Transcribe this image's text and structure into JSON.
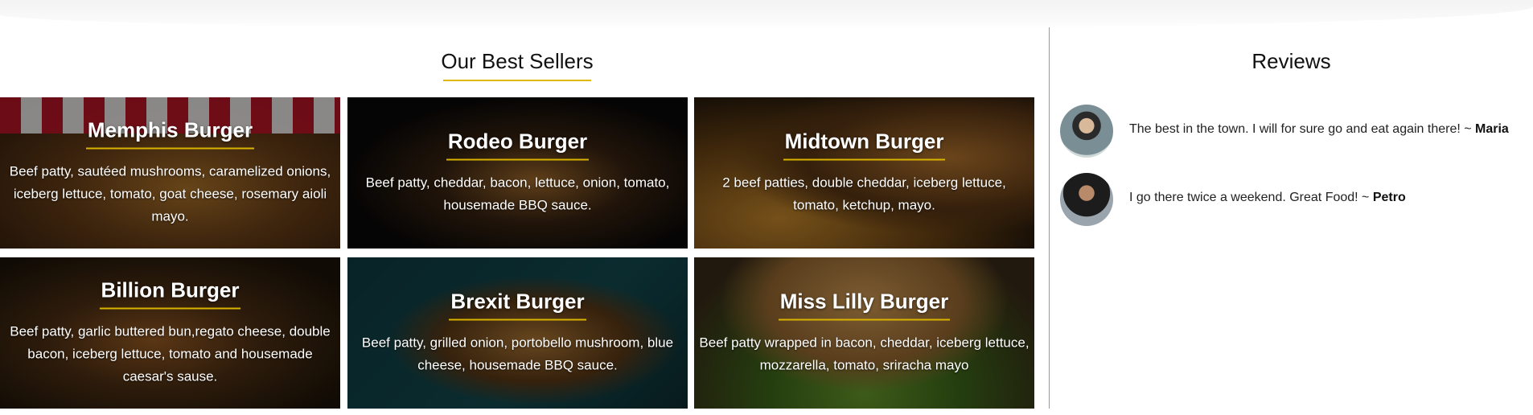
{
  "best_sellers": {
    "title": "Our Best Sellers",
    "items": [
      {
        "name": "Memphis Burger",
        "desc": "Beef patty, sautéed mushrooms, caramelized onions, iceberg lettuce, tomato, goat cheese, rosemary aioli mayo."
      },
      {
        "name": "Rodeo Burger",
        "desc": "Beef patty, cheddar, bacon, lettuce, onion, tomato, housemade BBQ sauce."
      },
      {
        "name": "Midtown Burger",
        "desc": "2 beef patties, double cheddar, iceberg lettuce, tomato, ketchup, mayo."
      },
      {
        "name": "Billion Burger",
        "desc": "Beef patty, garlic buttered bun,regato cheese, double bacon, iceberg lettuce, tomato and housemade caesar's sause."
      },
      {
        "name": "Brexit Burger",
        "desc": "Beef patty, grilled onion, portobello mushroom, blue cheese, housemade BBQ sauce."
      },
      {
        "name": "Miss Lilly Burger",
        "desc": "Beef patty wrapped in bacon, cheddar, iceberg lettuce, mozzarella, tomato, sriracha mayo"
      }
    ]
  },
  "reviews": {
    "title": "Reviews",
    "items": [
      {
        "text": "The best in the town. I will for sure go and eat again there! ~ ",
        "author": "Maria"
      },
      {
        "text": "I go there twice a weekend. Great Food! ~ ",
        "author": "Petro"
      }
    ]
  },
  "colors": {
    "accent_underline": "#e0b800",
    "divider": "#9a9a9a"
  }
}
